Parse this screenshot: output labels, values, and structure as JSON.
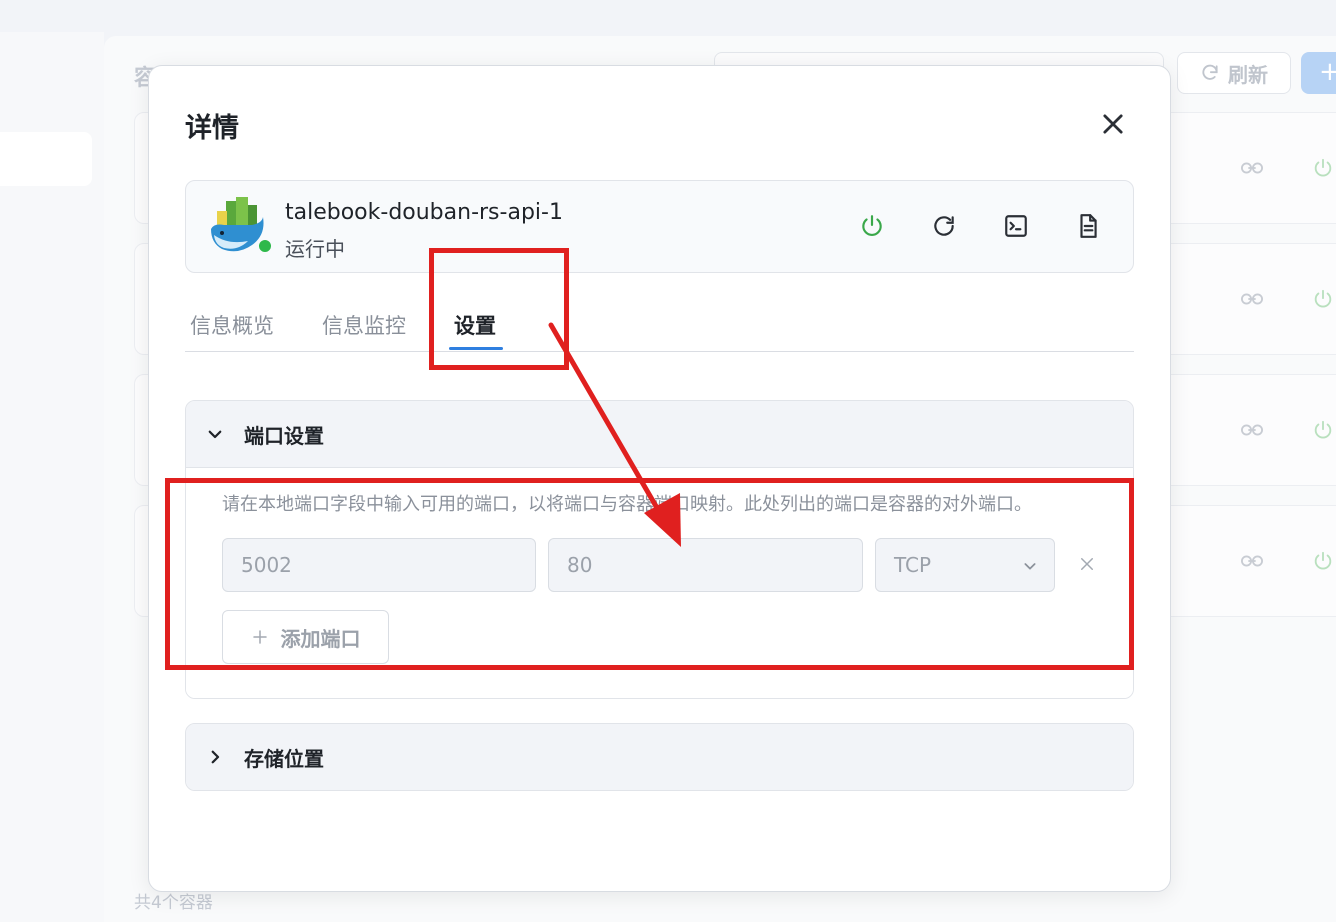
{
  "background": {
    "page_title": "容器",
    "refresh_label": "刷新",
    "add_label": "+",
    "footer_count": "共4个容器"
  },
  "modal": {
    "title": "详情",
    "container": {
      "name": "talebook-douban-rs-api-1",
      "status": "运行中",
      "status_color": "#2eb84a"
    },
    "actions": [
      "power-icon",
      "restart-icon",
      "terminal-icon",
      "log-file-icon"
    ],
    "tabs": [
      {
        "label": "信息概览",
        "active": false
      },
      {
        "label": "信息监控",
        "active": false
      },
      {
        "label": "设置",
        "active": true
      }
    ],
    "port_settings": {
      "title": "端口设置",
      "expanded": true,
      "hint": "请在本地端口字段中输入可用的端口，以将端口与容器端口映射。此处列出的端口是容器的对外端口。",
      "mapping": {
        "local_port": "5002",
        "container_port": "80",
        "protocol": "TCP"
      },
      "add_port_label": "添加端口"
    },
    "storage": {
      "title": "存储位置",
      "expanded": false
    }
  },
  "colors": {
    "accent": "#2f7fe0",
    "annotation": "#e0201f",
    "power_green": "#3aa84a"
  }
}
